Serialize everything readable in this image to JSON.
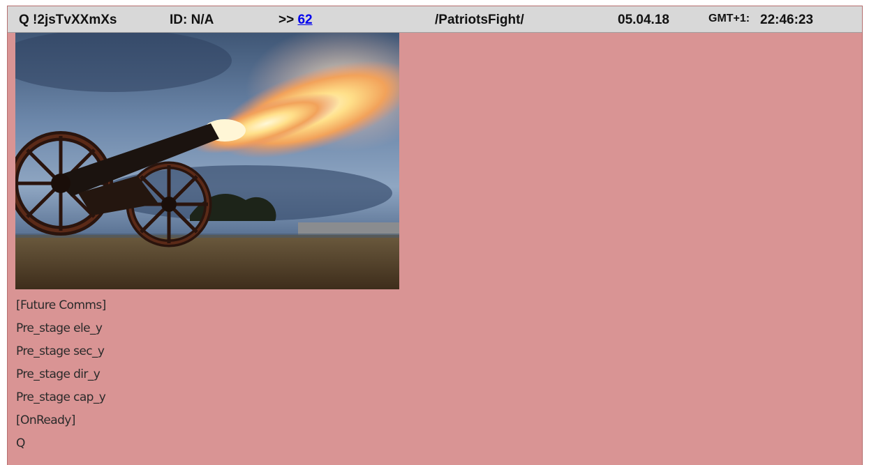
{
  "header": {
    "tripcode": "Q !2jsTvXXmXs",
    "id_label": "ID: N/A",
    "ref_prefix": ">>",
    "ref_number": "62",
    "board": "/PatriotsFight/",
    "date": "05.04.18",
    "tz_label": "GMT+1:",
    "time": "22:46:23"
  },
  "post": {
    "image_subject": "cannon-firing-image",
    "lines": [
      "[Future Comms]",
      "Pre_stage ele_y",
      "Pre_stage sec_y",
      "Pre_stage dir_y",
      "Pre_stage cap_y",
      "[OnReady]",
      "Q"
    ]
  },
  "colors": {
    "post_background": "#d99494",
    "header_background": "#d8d8d8",
    "link": "#0000ee"
  }
}
